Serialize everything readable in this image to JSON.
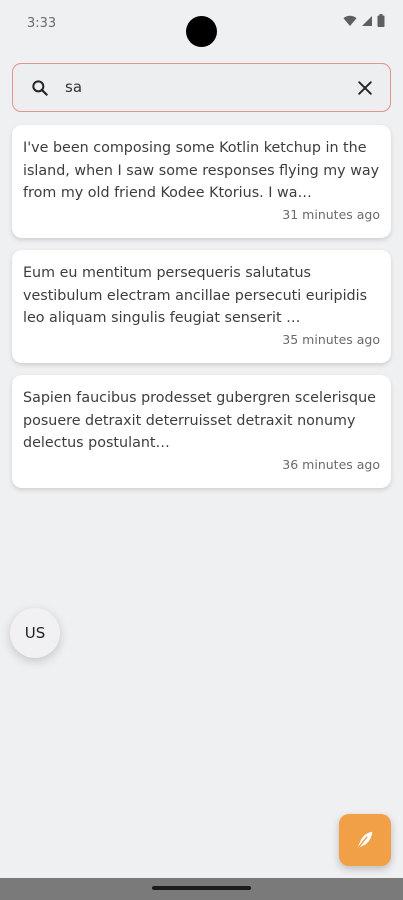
{
  "status": {
    "time": "3:33"
  },
  "search": {
    "query": "sa"
  },
  "notes": [
    {
      "text": "I've been composing some Kotlin ketchup in the island, when I saw some responses flying my way from my old friend Kodee Ktorius. I wa…",
      "time": "31 minutes ago"
    },
    {
      "text": "Eum eu mentitum persequeris salutatus vestibulum electram ancillae persecuti euripidis leo aliquam singulis feugiat senserit …",
      "time": "35 minutes ago"
    },
    {
      "text": "Sapien faucibus prodesset gubergren scelerisque posuere detraxit deterruisset detraxit nonumy delectus postulant…",
      "time": "36 minutes ago"
    }
  ],
  "account": {
    "initials": "US"
  },
  "icons": {
    "search": "search-icon",
    "clear": "close-icon",
    "fab": "feather-icon",
    "wifi": "wifi-icon",
    "signal": "signal-icon",
    "battery": "battery-icon"
  },
  "colors": {
    "accent": "#f2a046",
    "search_border": "#e6938b",
    "background": "#eff0f2"
  }
}
